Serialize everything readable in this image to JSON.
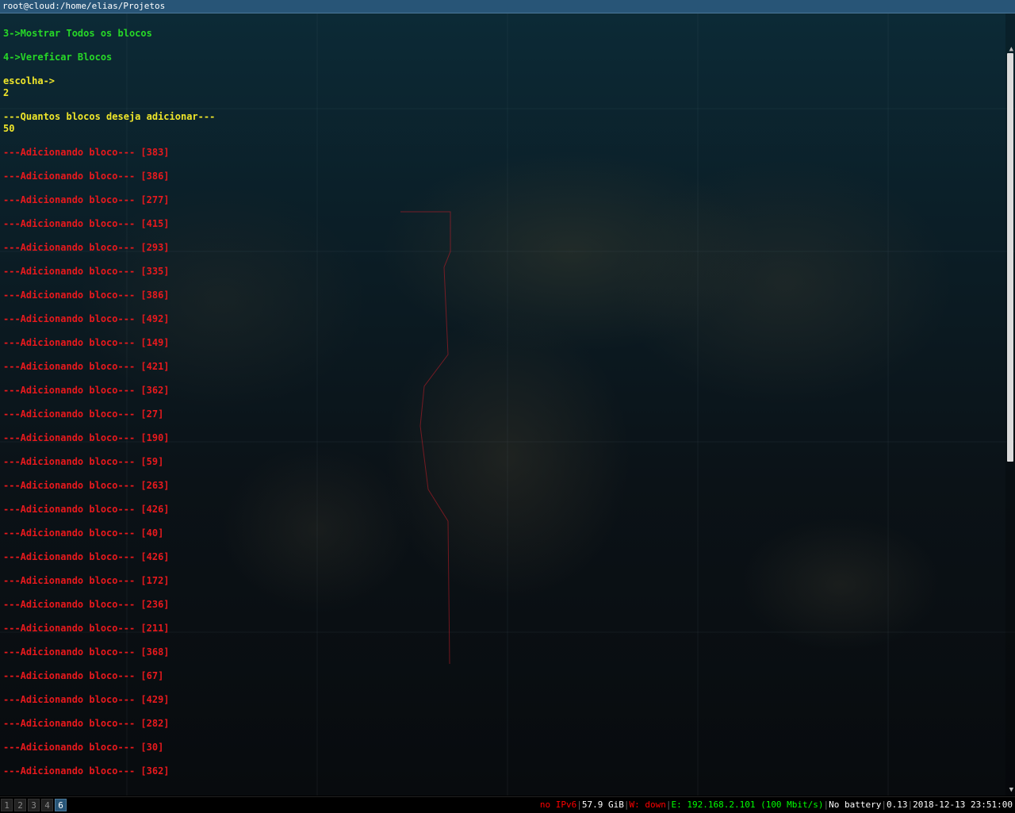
{
  "window": {
    "title": "root@cloud:/home/elias/Projetos"
  },
  "terminal": {
    "lines": [
      {
        "text": "3->Mostrar Todos os blocos",
        "color": "green"
      },
      {
        "text": "",
        "color": "green"
      },
      {
        "text": "4->Vereficar Blocos",
        "color": "green"
      },
      {
        "text": "",
        "color": "green"
      },
      {
        "text": "escolha->",
        "color": "yellow"
      },
      {
        "text": "2",
        "color": "yellow"
      },
      {
        "text": "",
        "color": "yellow"
      },
      {
        "text": "---Quantos blocos deseja adicionar---",
        "color": "yellow"
      },
      {
        "text": "50",
        "color": "yellow"
      },
      {
        "text": "",
        "color": "red"
      },
      {
        "text": "---Adicionando bloco--- [383]",
        "color": "red"
      },
      {
        "text": "",
        "color": "red"
      },
      {
        "text": "---Adicionando bloco--- [386]",
        "color": "red"
      },
      {
        "text": "",
        "color": "red"
      },
      {
        "text": "---Adicionando bloco--- [277]",
        "color": "red"
      },
      {
        "text": "",
        "color": "red"
      },
      {
        "text": "---Adicionando bloco--- [415]",
        "color": "red"
      },
      {
        "text": "",
        "color": "red"
      },
      {
        "text": "---Adicionando bloco--- [293]",
        "color": "red"
      },
      {
        "text": "",
        "color": "red"
      },
      {
        "text": "---Adicionando bloco--- [335]",
        "color": "red"
      },
      {
        "text": "",
        "color": "red"
      },
      {
        "text": "---Adicionando bloco--- [386]",
        "color": "red"
      },
      {
        "text": "",
        "color": "red"
      },
      {
        "text": "---Adicionando bloco--- [492]",
        "color": "red"
      },
      {
        "text": "",
        "color": "red"
      },
      {
        "text": "---Adicionando bloco--- [149]",
        "color": "red"
      },
      {
        "text": "",
        "color": "red"
      },
      {
        "text": "---Adicionando bloco--- [421]",
        "color": "red"
      },
      {
        "text": "",
        "color": "red"
      },
      {
        "text": "---Adicionando bloco--- [362]",
        "color": "red"
      },
      {
        "text": "",
        "color": "red"
      },
      {
        "text": "---Adicionando bloco--- [27]",
        "color": "red"
      },
      {
        "text": "",
        "color": "red"
      },
      {
        "text": "---Adicionando bloco--- [190]",
        "color": "red"
      },
      {
        "text": "",
        "color": "red"
      },
      {
        "text": "---Adicionando bloco--- [59]",
        "color": "red"
      },
      {
        "text": "",
        "color": "red"
      },
      {
        "text": "---Adicionando bloco--- [263]",
        "color": "red"
      },
      {
        "text": "",
        "color": "red"
      },
      {
        "text": "---Adicionando bloco--- [426]",
        "color": "red"
      },
      {
        "text": "",
        "color": "red"
      },
      {
        "text": "---Adicionando bloco--- [40]",
        "color": "red"
      },
      {
        "text": "",
        "color": "red"
      },
      {
        "text": "---Adicionando bloco--- [426]",
        "color": "red"
      },
      {
        "text": "",
        "color": "red"
      },
      {
        "text": "---Adicionando bloco--- [172]",
        "color": "red"
      },
      {
        "text": "",
        "color": "red"
      },
      {
        "text": "---Adicionando bloco--- [236]",
        "color": "red"
      },
      {
        "text": "",
        "color": "red"
      },
      {
        "text": "---Adicionando bloco--- [211]",
        "color": "red"
      },
      {
        "text": "",
        "color": "red"
      },
      {
        "text": "---Adicionando bloco--- [368]",
        "color": "red"
      },
      {
        "text": "",
        "color": "red"
      },
      {
        "text": "---Adicionando bloco--- [67]",
        "color": "red"
      },
      {
        "text": "",
        "color": "red"
      },
      {
        "text": "---Adicionando bloco--- [429]",
        "color": "red"
      },
      {
        "text": "",
        "color": "red"
      },
      {
        "text": "---Adicionando bloco--- [282]",
        "color": "red"
      },
      {
        "text": "",
        "color": "red"
      },
      {
        "text": "---Adicionando bloco--- [30]",
        "color": "red"
      },
      {
        "text": "",
        "color": "red"
      },
      {
        "text": "---Adicionando bloco--- [362]",
        "color": "red"
      }
    ]
  },
  "workspaces": [
    {
      "label": "1",
      "focused": false
    },
    {
      "label": "2",
      "focused": false
    },
    {
      "label": "3",
      "focused": false
    },
    {
      "label": "4",
      "focused": false
    },
    {
      "label": "6",
      "focused": true
    }
  ],
  "status": {
    "ipv6": "no IPv6",
    "disk": "57.9 GiB",
    "wireless": "W: down",
    "ethernet": "E: 192.168.2.101 (100 Mbit/s)",
    "battery": "No battery",
    "load": "0.13",
    "datetime": "2018-12-13 23:51:00",
    "colors": {
      "ipv6": "#ff0000",
      "disk": "#ffffff",
      "wireless": "#ff0000",
      "ethernet": "#00ff00",
      "battery": "#ffffff",
      "load": "#ffffff",
      "datetime": "#ffffff"
    }
  },
  "colors": {
    "green": "#27d827",
    "yellow": "#f0e62a",
    "red": "#e8191d",
    "titlebar": "#285577"
  }
}
